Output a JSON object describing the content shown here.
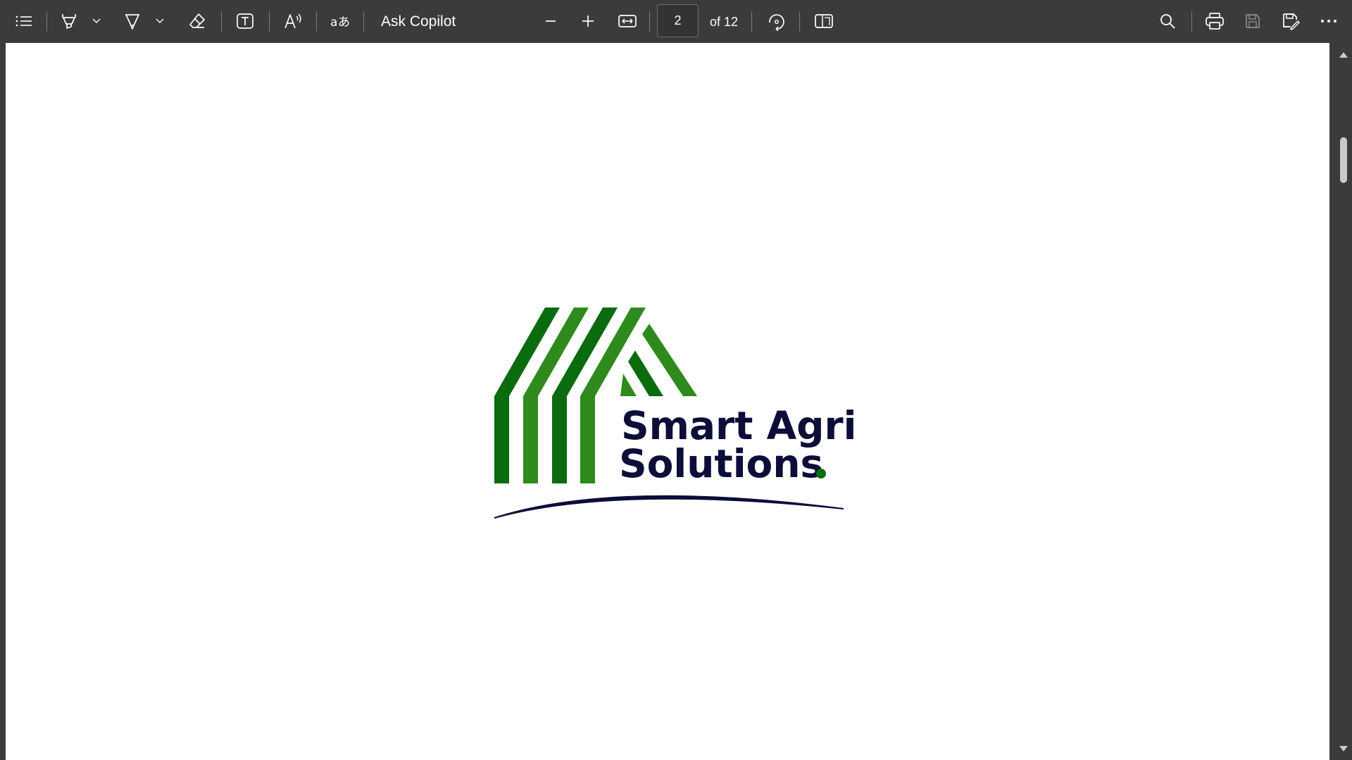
{
  "toolbar": {
    "ask_copilot_label": "Ask Copilot",
    "page_current": "2",
    "page_total_label": "of 12",
    "icons": [
      "contents-list-icon",
      "highlight-icon",
      "draw-icon",
      "erase-icon",
      "add-text-icon",
      "read-aloud-icon",
      "translate-icon",
      "zoom-out-icon",
      "zoom-in-icon",
      "fit-to-width-icon",
      "rotate-icon",
      "page-view-icon",
      "search-icon",
      "print-icon",
      "save-icon",
      "save-as-icon",
      "more-options-icon"
    ]
  },
  "document": {
    "logo": {
      "line1": "Smart Agri",
      "line2": "Solutions",
      "colors": {
        "dark_green": "#0a6b0f",
        "light_green": "#2e8a1c",
        "navy": "#0d0d3a"
      }
    }
  },
  "theme": {
    "toolbar_bg": "#3b3b3b",
    "page_bg": "#ffffff",
    "icon_color": "#ffffff"
  }
}
